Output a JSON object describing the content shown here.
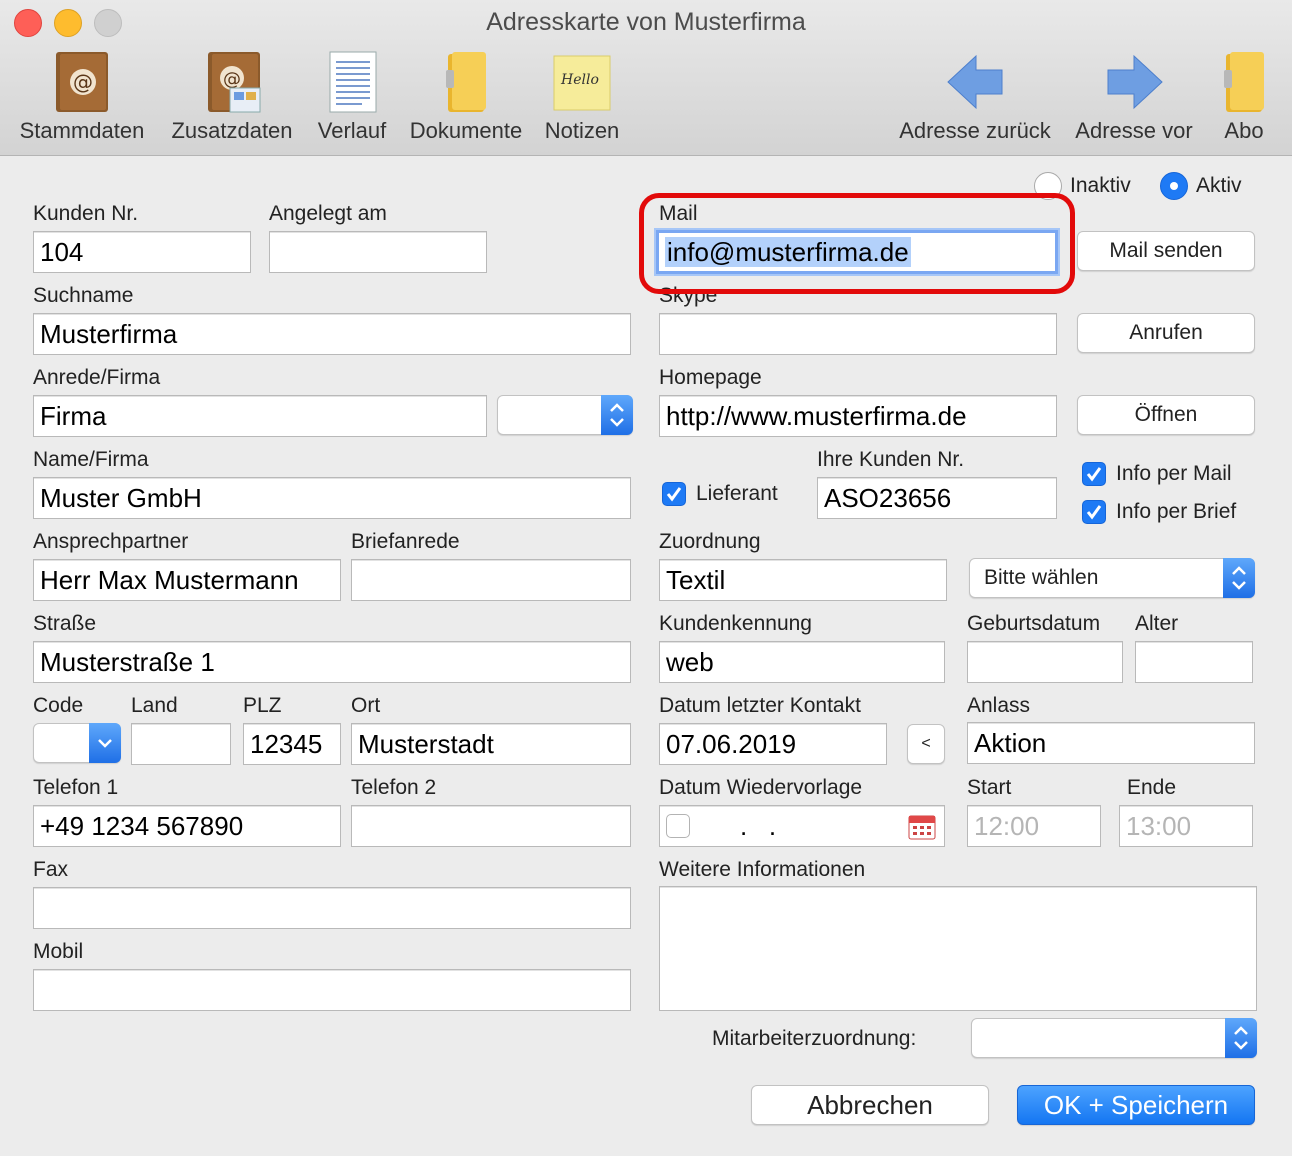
{
  "window": {
    "title": "Adresskarte von Musterfirma"
  },
  "toolbar": {
    "stammdaten": "Stammdaten",
    "zusatzdaten": "Zusatzdaten",
    "verlauf": "Verlauf",
    "dokumente": "Dokumente",
    "notizen": "Notizen",
    "notizen_icon_text": "Hello",
    "adresse_zurueck": "Adresse zurück",
    "adresse_vor": "Adresse vor",
    "abo": "Abo"
  },
  "status": {
    "inaktiv": "Inaktiv",
    "aktiv": "Aktiv",
    "selected": "Aktiv"
  },
  "left": {
    "kunden_nr_label": "Kunden Nr.",
    "kunden_nr": "104",
    "angelegt_label": "Angelegt am",
    "angelegt": "",
    "suchname_label": "Suchname",
    "suchname": "Musterfirma",
    "anrede_label": "Anrede/Firma",
    "anrede": "Firma",
    "anrede_select": "",
    "name_label": "Name/Firma",
    "name": "Muster GmbH",
    "ansprech_label": "Ansprechpartner",
    "ansprech": "Herr Max Mustermann",
    "briefanrede_label": "Briefanrede",
    "briefanrede": "",
    "strasse_label": "Straße",
    "strasse": "Musterstraße 1",
    "code_label": "Code",
    "code": "",
    "land_label": "Land",
    "land": "",
    "plz_label": "PLZ",
    "plz": "12345",
    "ort_label": "Ort",
    "ort": "Musterstadt",
    "tel1_label": "Telefon 1",
    "tel1": "+49 1234 567890",
    "tel2_label": "Telefon 2",
    "tel2": "",
    "fax_label": "Fax",
    "fax": "",
    "mobil_label": "Mobil",
    "mobil": ""
  },
  "right": {
    "mail_label": "Mail",
    "mail": "info@musterfirma.de",
    "mail_button": "Mail senden",
    "skype_label": "Skype",
    "skype": "",
    "skype_button": "Anrufen",
    "homepage_label": "Homepage",
    "homepage": "http://www.musterfirma.de",
    "homepage_button": "Öffnen",
    "lieferant": "Lieferant",
    "lieferant_checked": true,
    "ihre_kunden_label": "Ihre Kunden Nr.",
    "ihre_kunden": "ASO23656",
    "info_mail": "Info per Mail",
    "info_mail_checked": true,
    "info_brief": "Info per Brief",
    "info_brief_checked": true,
    "zuordnung_label": "Zuordnung",
    "zuordnung": "Textil",
    "zuordnung_select": "Bitte wählen",
    "kundenkennung_label": "Kundenkennung",
    "kundenkennung": "web",
    "geburtsdatum_label": "Geburtsdatum",
    "geburtsdatum": "",
    "alter_label": "Alter",
    "alter": "",
    "letzter_kontakt_label": "Datum letzter Kontakt",
    "letzter_kontakt": "07.06.2019",
    "kontakt_button": "<",
    "anlass_label": "Anlass",
    "anlass": "Aktion",
    "wiedervorlage_label": "Datum Wiedervorlage",
    "wiedervorlage": ".   .",
    "start_label": "Start",
    "start": "12:00",
    "ende_label": "Ende",
    "ende": "13:00",
    "weitere_label": "Weitere Informationen",
    "weitere": "",
    "mitarbeiter_label": "Mitarbeiterzuordnung:",
    "mitarbeiter": ""
  },
  "footer": {
    "cancel": "Abbrechen",
    "ok": "OK + Speichern"
  },
  "colors": {
    "accent": "#1e7af5",
    "highlight": "#e20a0a"
  }
}
